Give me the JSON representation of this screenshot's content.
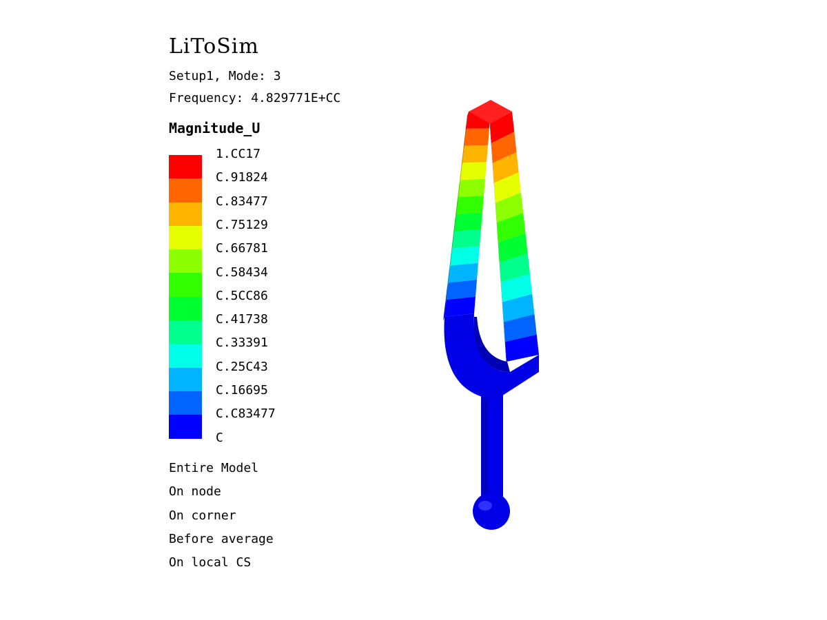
{
  "app_title": "LiToSim",
  "setup_line": "Setup1, Mode: 3",
  "frequency_line": "Frequency: 4.829771E+CC",
  "field_name": "Magnitude_U",
  "legend": {
    "labels": [
      "1.CC17",
      "C.91824",
      "C.83477",
      "C.75129",
      "C.66781",
      "C.58434",
      "C.5CC86",
      "C.41738",
      "C.33391",
      "C.25C43",
      "C.16695",
      "C.C83477",
      "C"
    ],
    "colors": [
      "#ff0000",
      "#ff6600",
      "#ffb400",
      "#e6ff00",
      "#8cff00",
      "#32ff00",
      "#00ff32",
      "#00ff8c",
      "#00ffe6",
      "#00b4ff",
      "#0064ff",
      "#0000ff"
    ]
  },
  "notes": [
    "Entire Model",
    "On node",
    "On corner",
    "Before average",
    "On local CS"
  ]
}
